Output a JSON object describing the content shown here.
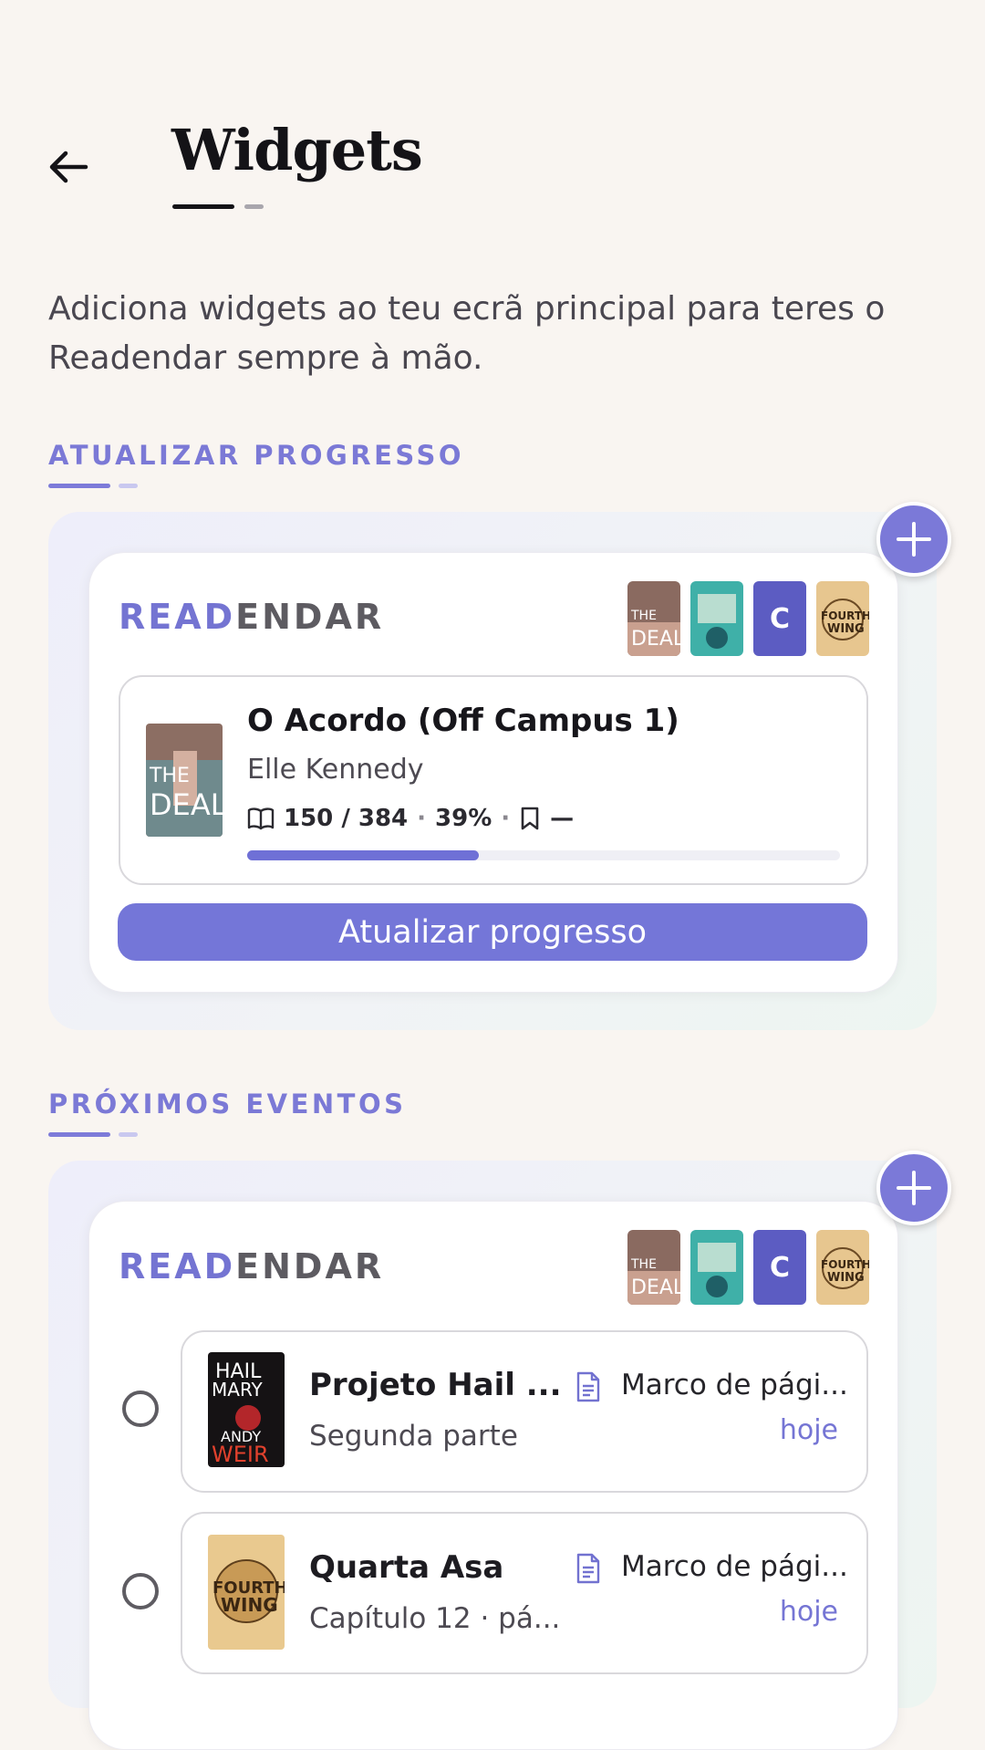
{
  "header": {
    "title": "Widgets"
  },
  "description": "Adiciona widgets ao teu ecrã principal para teres o Readendar sempre à mão.",
  "brand": {
    "highlight": "READ",
    "rest": "ENDAR"
  },
  "progress_section": {
    "label": "ATUALIZAR PROGRESSO",
    "widget": {
      "book_title": "O Acordo (Off Campus 1)",
      "author": "Elle Kennedy",
      "pages": "150 / 384",
      "percent": "39%",
      "progress_fraction": 0.39,
      "bookmark_value": "—",
      "button_label": "Atualizar progresso"
    }
  },
  "events_section": {
    "label": "PRÓXIMOS EVENTOS",
    "events": [
      {
        "title": "Projeto Hail ...",
        "subtitle": "Segunda parte",
        "type": "Marco de pági...",
        "when": "hoje"
      },
      {
        "title": "Quarta Asa",
        "subtitle": "Capítulo 12 · pá...",
        "type": "Marco de pági...",
        "when": "hoje"
      }
    ]
  },
  "cover_thumbs": {
    "c_initial": "C",
    "the_deal": "THE DEAL",
    "fourth_wing": "FOURTH WING",
    "hail_mary": "HAIL MARY",
    "andy_weir": "ANDY WEIR"
  },
  "colors": {
    "accent": "#7474d2",
    "background": "#f9f5f1"
  }
}
